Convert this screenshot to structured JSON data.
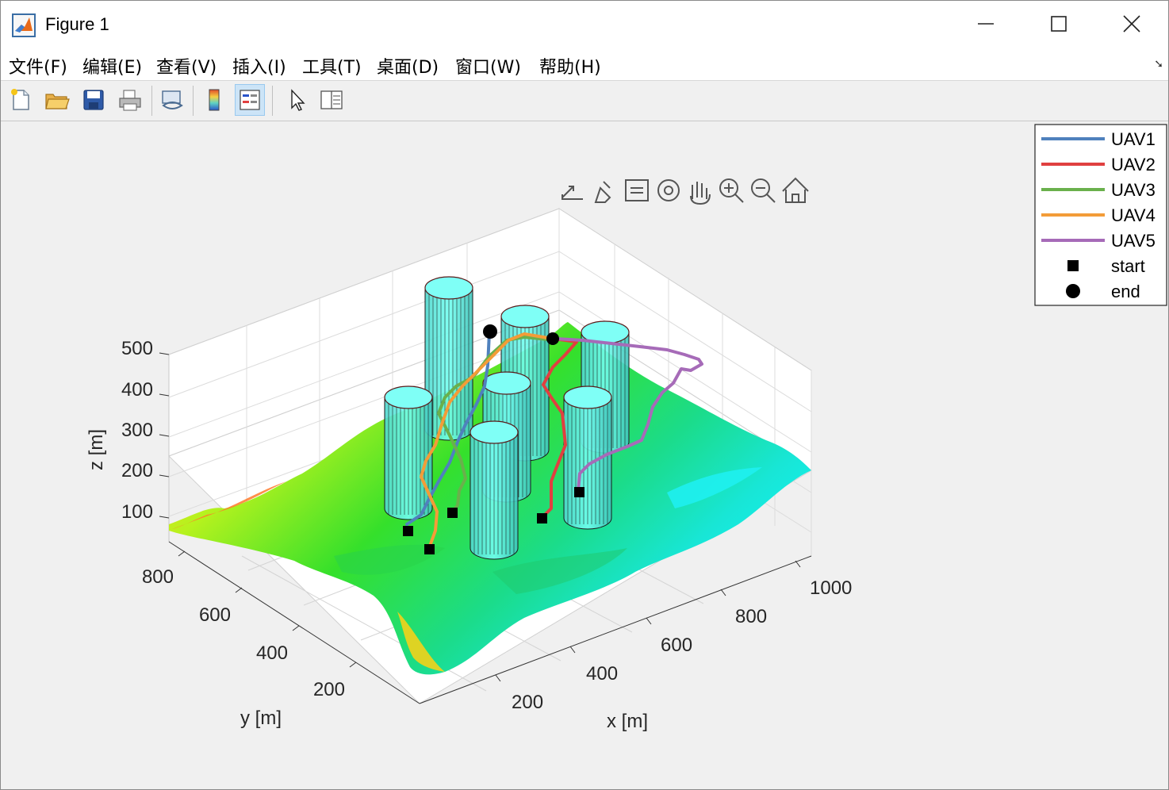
{
  "window": {
    "title": "Figure 1"
  },
  "menu": {
    "items": [
      "文件(F)",
      "编辑(E)",
      "查看(V)",
      "插入(I)",
      "工具(T)",
      "桌面(D)",
      "窗口(W)",
      "帮助(H)"
    ]
  },
  "toolbar": {
    "icons": [
      "new-figure-icon",
      "open-file-icon",
      "save-icon",
      "print-icon",
      "link-plot-icon",
      "colorbar-icon",
      "legend-icon",
      "edit-plot-icon",
      "property-inspector-icon"
    ]
  },
  "axes_toolbar": {
    "icons": [
      "export-icon",
      "brush-icon",
      "datatip-icon",
      "rotate-3d-icon",
      "pan-icon",
      "zoom-in-icon",
      "zoom-out-icon",
      "home-icon"
    ]
  },
  "chart_data": {
    "type": "3d-surface-with-paths",
    "xlabel": "x [m]",
    "ylabel": "y [m]",
    "zlabel": "z [m]",
    "x_ticks": [
      "200",
      "400",
      "600",
      "800",
      "1000"
    ],
    "y_ticks": [
      "200",
      "400",
      "600",
      "800"
    ],
    "z_ticks": [
      "100",
      "200",
      "300",
      "400",
      "500"
    ],
    "legend": {
      "position": "top-right",
      "entries": [
        {
          "label": "UAV1",
          "color": "#4f81bd",
          "marker": "line"
        },
        {
          "label": "UAV2",
          "color": "#e04040",
          "marker": "line"
        },
        {
          "label": "UAV3",
          "color": "#6ab04c",
          "marker": "line"
        },
        {
          "label": "UAV4",
          "color": "#f39c38",
          "marker": "line"
        },
        {
          "label": "UAV5",
          "color": "#a66bb8",
          "marker": "line"
        },
        {
          "label": "start",
          "color": "#000000",
          "marker": "square"
        },
        {
          "label": "end",
          "color": "#000000",
          "marker": "circle"
        }
      ]
    },
    "obstacles": "cylinders (cyan)",
    "terrain_colormap": "jet"
  }
}
